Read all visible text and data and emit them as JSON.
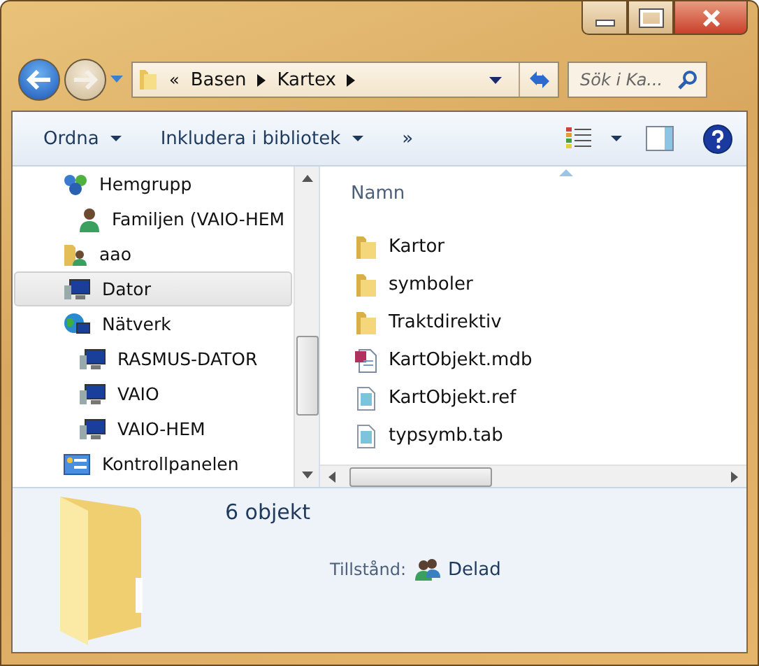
{
  "address_bar": {
    "overflow": "«",
    "crumbs": [
      "Basen",
      "Kartex"
    ]
  },
  "search": {
    "placeholder": "Sök i Ka..."
  },
  "toolbar": {
    "buttons": [
      {
        "label": "Ordna",
        "dropdown": true
      },
      {
        "label": "Inkludera i bibliotek",
        "dropdown": true
      }
    ],
    "more": "»"
  },
  "sidebar": {
    "items": [
      {
        "label": "Hemgrupp",
        "kind": "homegroup",
        "selected": false,
        "children": [
          {
            "label": "Familjen (VAIO-HEM",
            "kind": "user",
            "selected": false
          }
        ]
      },
      {
        "label": "aao",
        "kind": "userfolder",
        "selected": false
      },
      {
        "label": "Dator",
        "kind": "computer",
        "selected": true
      },
      {
        "label": "Nätverk",
        "kind": "network",
        "selected": false,
        "children": [
          {
            "label": "RASMUS-DATOR",
            "kind": "computer",
            "selected": false
          },
          {
            "label": "VAIO",
            "kind": "computer",
            "selected": false
          },
          {
            "label": "VAIO-HEM",
            "kind": "computer",
            "selected": false
          }
        ]
      },
      {
        "label": "Kontrollpanelen",
        "kind": "controlpanel",
        "selected": false
      }
    ]
  },
  "file_list": {
    "columns": [
      "Namn"
    ],
    "rows": [
      {
        "name": "Kartor",
        "kind": "folder"
      },
      {
        "name": "symboler",
        "kind": "folder"
      },
      {
        "name": "Traktdirektiv",
        "kind": "folder"
      },
      {
        "name": "KartObjekt.mdb",
        "kind": "access"
      },
      {
        "name": "KartObjekt.ref",
        "kind": "file"
      },
      {
        "name": "typsymb.tab",
        "kind": "file"
      }
    ]
  },
  "details": {
    "count": "6 objekt",
    "state_label": "Tillstånd:",
    "state_value": "Delad"
  }
}
